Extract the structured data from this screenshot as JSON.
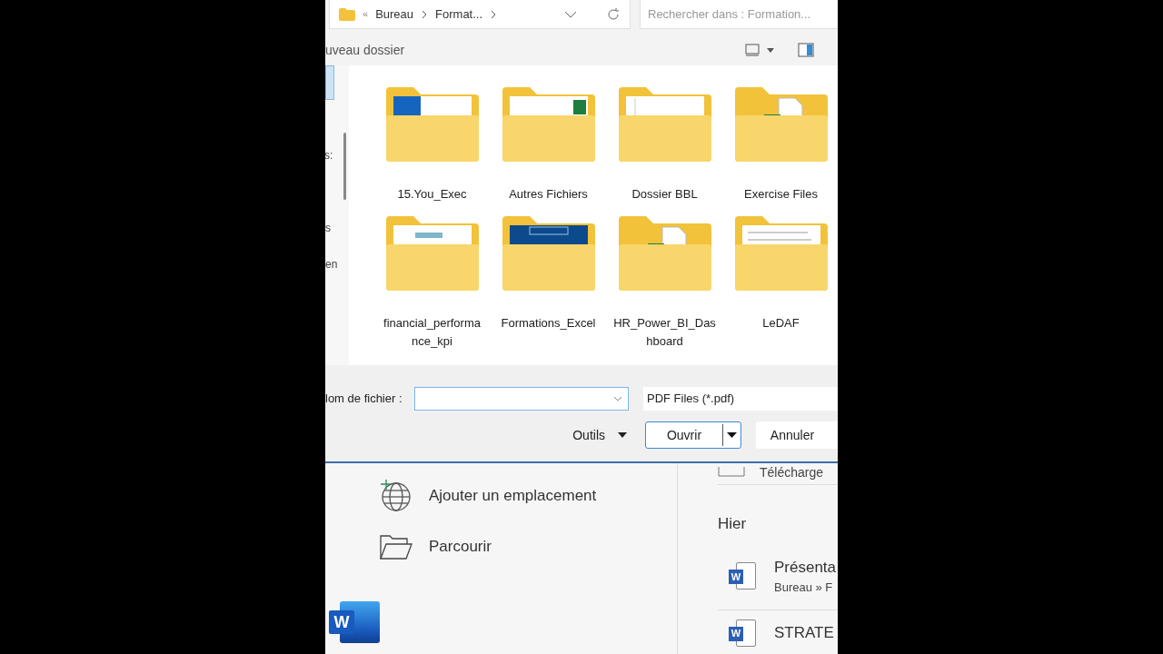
{
  "dialog": {
    "address": {
      "prefix": "«",
      "crumbs": [
        "Bureau",
        "Format..."
      ]
    },
    "search": {
      "placeholder": "Rechercher dans : Formation..."
    },
    "toolbar": {
      "new_folder": "uveau dossier"
    },
    "nav_fragments": [
      "s:",
      "s",
      "en"
    ],
    "folders": [
      {
        "name": "15.You_Exec",
        "kind": "blue-doc"
      },
      {
        "name": "Autres Fichiers",
        "kind": "excel-doc"
      },
      {
        "name": "Dossier BBL",
        "kind": "sheet"
      },
      {
        "name": "Exercise Files",
        "kind": "excel-file"
      },
      {
        "name": "financial_performance_kpi",
        "kind": "chart"
      },
      {
        "name": "Formations_Excel",
        "kind": "banner"
      },
      {
        "name": "HR_Power_BI_Dashboard",
        "kind": "excel-file"
      },
      {
        "name": "LeDAF",
        "kind": "text"
      }
    ],
    "filename": {
      "label": "lom de fichier :"
    },
    "filetype": "PDF Files (*.pdf)",
    "tools": "Outils",
    "open": "Ouvrir",
    "cancel": "Annuler"
  },
  "backstage": {
    "actions": [
      {
        "label": "Ajouter un emplacement",
        "kind": "globe"
      },
      {
        "label": "Parcourir",
        "kind": "folder"
      }
    ],
    "app_letter": "W",
    "recent_top": "Télécharge",
    "group": "Hier",
    "recent": [
      {
        "title": "Présenta",
        "path": "Bureau » F",
        "icon_letter": "W"
      },
      {
        "title": "STRATE",
        "icon_letter": "W"
      }
    ]
  }
}
